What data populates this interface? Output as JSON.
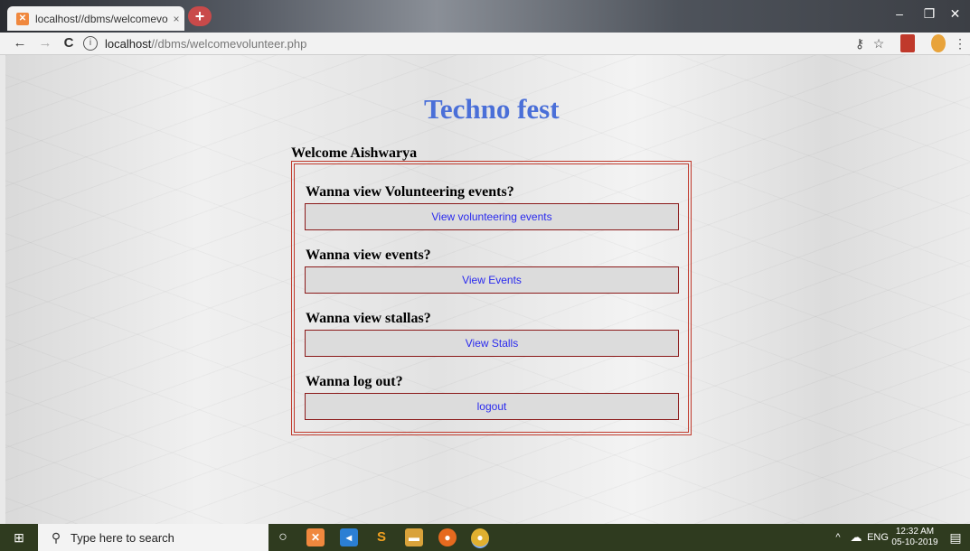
{
  "browser": {
    "tab_title": "localhost//dbms/welcomevolunt",
    "tab_close": "×",
    "new_tab": "+",
    "url_host": "localhost",
    "url_path": "//dbms/welcomevolunteer.php",
    "back": "←",
    "forward": "→",
    "reload": "C",
    "info": "i",
    "key_icon": "⚷",
    "star_icon": "☆",
    "menu_icon": "⋮",
    "minimize": "–",
    "maximize": "❐",
    "close": "✕"
  },
  "page": {
    "title": "Techno fest",
    "welcome": "Welcome Aishwarya",
    "sections": [
      {
        "question": "Wanna view Volunteering events?",
        "button": "View volunteering events"
      },
      {
        "question": "Wanna view events?",
        "button": "View Events"
      },
      {
        "question": "Wanna view stallas?",
        "button": "View Stalls"
      },
      {
        "question": "Wanna log out?",
        "button": "logout"
      }
    ]
  },
  "taskbar": {
    "start_icon": "⊞",
    "search_icon": "⚲",
    "search_placeholder": "Type here to search",
    "task_view_icon": "○",
    "tray_chevron": "^",
    "cloud_icon": "☁",
    "language": "ENG",
    "time": "12:32 AM",
    "date": "05-10-2019",
    "notification_icon": "▤"
  },
  "colors": {
    "title_blue": "#4a6fd8",
    "border_red": "#c0392b",
    "button_text_blue": "#2a2aee",
    "taskbar": "#2f3b1f"
  }
}
